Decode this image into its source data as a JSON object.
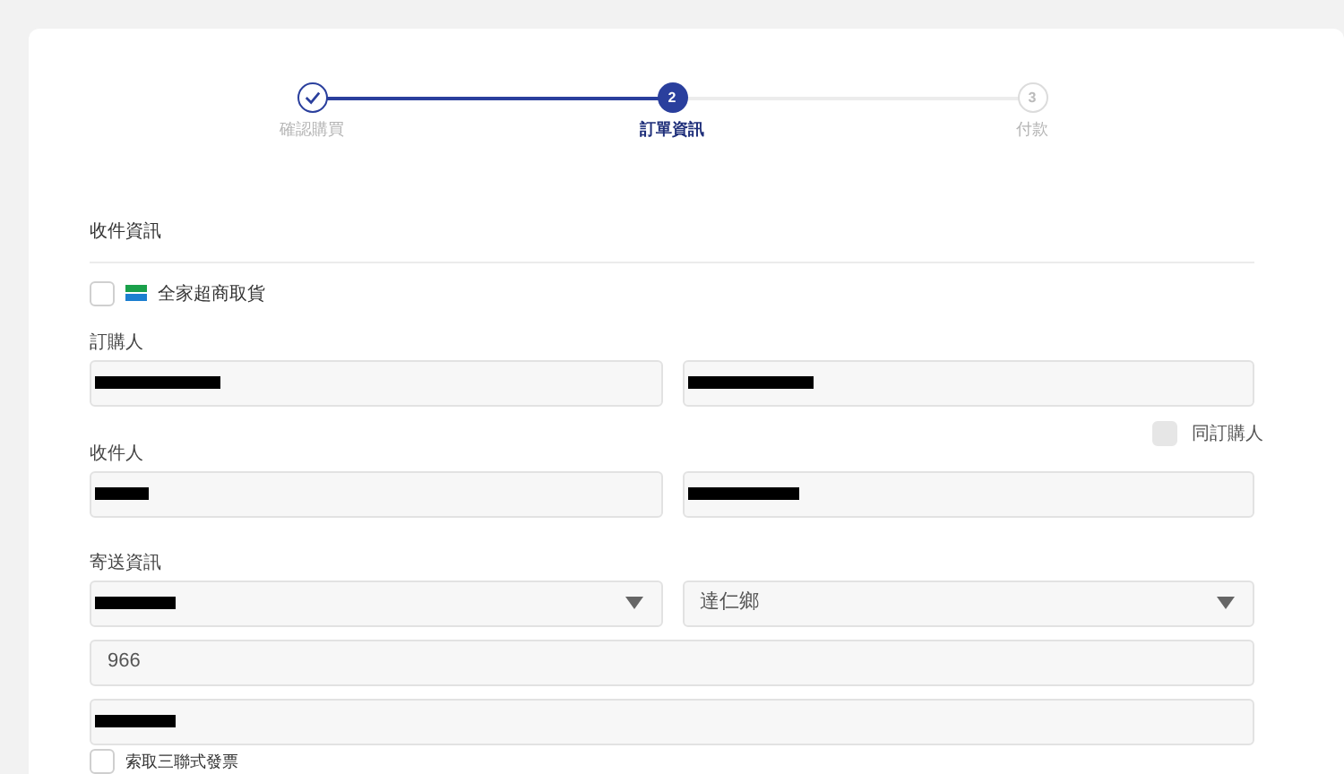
{
  "steps": [
    {
      "label": "確認購買",
      "done": true,
      "selected": false
    },
    {
      "number": "2",
      "label": "訂單資訊",
      "done": false,
      "selected": true
    },
    {
      "number": "3",
      "label": "付款",
      "done": false,
      "selected": false
    }
  ],
  "section_title": "收件資訊",
  "pickup_option": {
    "label": "全家超商取貨",
    "checked": false
  },
  "buyer": {
    "label": "訂購人",
    "fields": [
      {
        "redacted": true
      },
      {
        "redacted": true
      }
    ]
  },
  "same_as_buyer": {
    "label": "同訂購人",
    "checked": false
  },
  "recipient": {
    "label": "收件人",
    "fields": [
      {
        "redacted": true
      },
      {
        "redacted": true
      }
    ]
  },
  "shipping": {
    "label": "寄送資訊",
    "selects": [
      {
        "redacted": true
      },
      {
        "value": "達仁鄉",
        "redacted": false
      }
    ],
    "fields": [
      {
        "value": "966",
        "redacted": false
      },
      {
        "redacted": true
      }
    ]
  },
  "invoice_option": {
    "label": "索取三聯式發票",
    "checked": false
  }
}
